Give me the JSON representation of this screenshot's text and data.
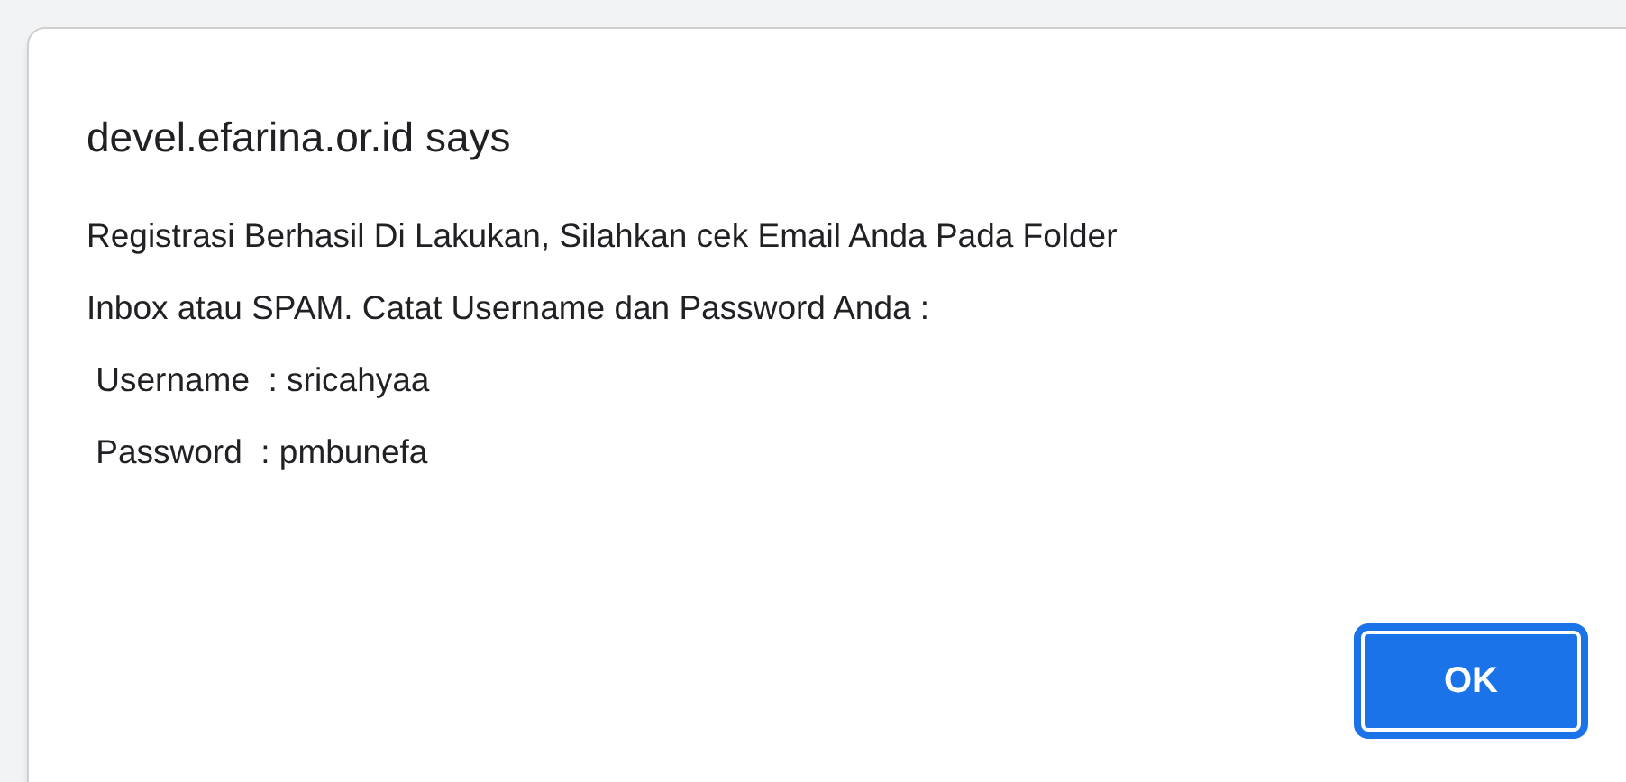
{
  "dialog": {
    "title": "devel.efarina.or.id says",
    "message_lines": [
      "Registrasi Berhasil Di Lakukan, Silahkan cek Email Anda Pada Folder",
      "Inbox atau SPAM. Catat Username dan Password Anda :",
      " Username  : sricahyaa",
      " Password  : pmbunefa"
    ],
    "buttons": [
      {
        "label": "OK",
        "focused": true
      }
    ]
  }
}
